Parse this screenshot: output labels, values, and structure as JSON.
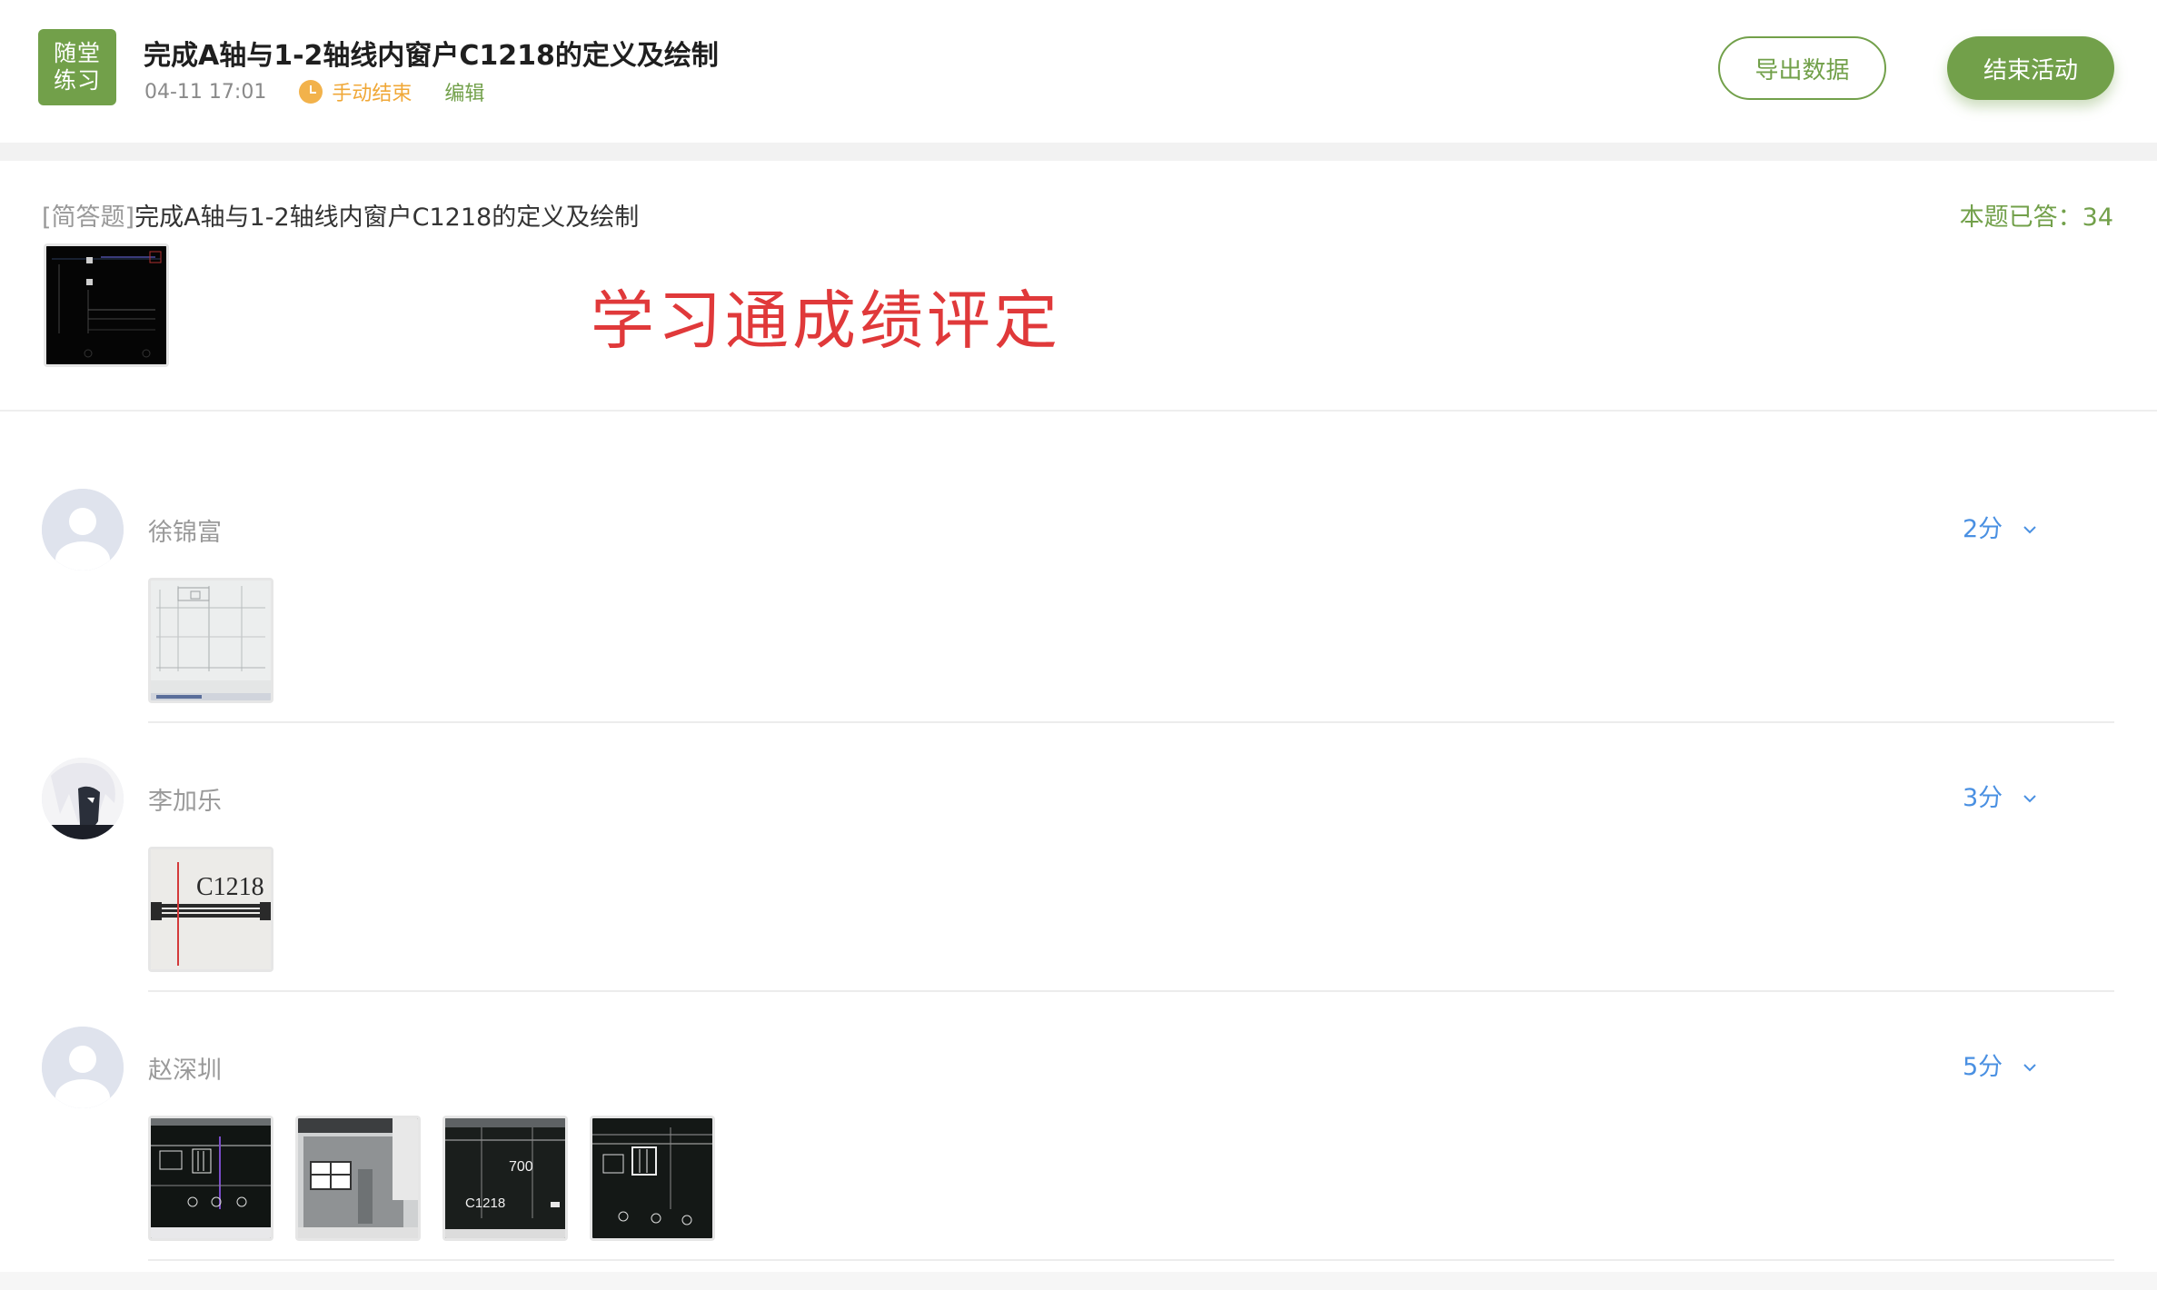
{
  "header": {
    "badge_line1": "随堂",
    "badge_line2": "练习",
    "title": "完成A轴与1-2轴线内窗户C1218的定义及绘制",
    "datetime": "04-11 17:01",
    "status": "手动结束",
    "edit_label": "编辑",
    "export_label": "导出数据",
    "end_label": "结束活动"
  },
  "question": {
    "type_label": "[简答题]",
    "text": "完成A轴与1-2轴线内窗户C1218的定义及绘制",
    "answered_label": "本题已答：34",
    "watermark": "学习通成绩评定"
  },
  "answers": [
    {
      "name": "徐锦富",
      "score": "2分",
      "images": [
        "drawing-sheet-photo"
      ]
    },
    {
      "name": "李加乐",
      "score": "3分",
      "images": [
        "c1218-window-photo"
      ],
      "image_text": "C1218"
    },
    {
      "name": "赵深圳",
      "score": "5分",
      "images": [
        "cad-screen-photo-1",
        "cad-screen-photo-2",
        "cad-screen-photo-3",
        "cad-screen-photo-4"
      ],
      "image_texts": [
        "700",
        "C1218"
      ]
    }
  ],
  "colors": {
    "accent_green": "#72a04a",
    "status_orange": "#f0a838",
    "score_blue": "#4a90e2",
    "watermark_red": "#e0393a"
  }
}
